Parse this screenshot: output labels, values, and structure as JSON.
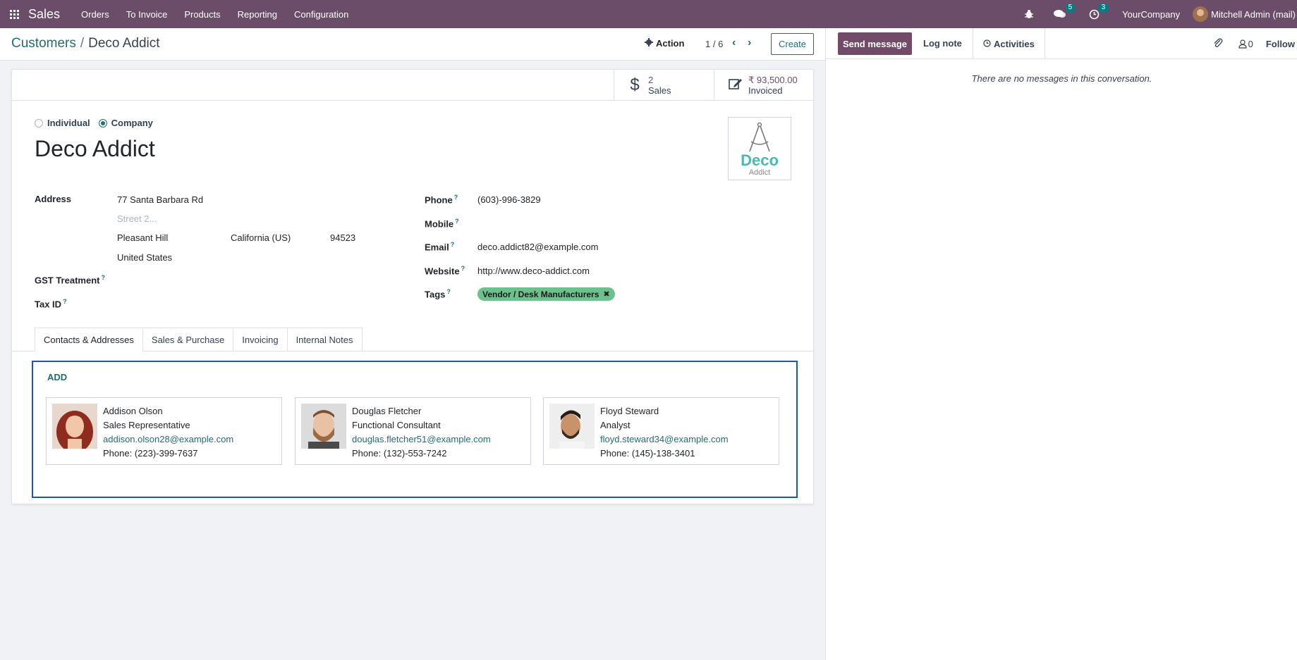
{
  "navbar": {
    "app_name": "Sales",
    "menu": [
      "Orders",
      "To Invoice",
      "Products",
      "Reporting",
      "Configuration"
    ],
    "messages_count": "5",
    "activities_count": "3",
    "company": "YourCompany",
    "user": "Mitchell Admin (mail)"
  },
  "breadcrumb": {
    "parent": "Customers",
    "separator": "/",
    "current": "Deco Addict"
  },
  "control": {
    "action_label": "Action",
    "pager": "1 / 6",
    "create_label": "Create"
  },
  "stats": [
    {
      "value": "2",
      "label": "Sales",
      "icon": "dollar-icon"
    },
    {
      "value": "₹ 93,500.00",
      "label": "Invoiced",
      "icon": "edit-invoice-icon"
    }
  ],
  "company_type": {
    "individual": "Individual",
    "company": "Company",
    "selected": "Company"
  },
  "partner": {
    "name": "Deco Addict",
    "logo_text": "Deco",
    "logo_sub": "Addict"
  },
  "address": {
    "label": "Address",
    "street": "77 Santa Barbara Rd",
    "street2_placeholder": "Street 2...",
    "city": "Pleasant Hill",
    "state": "California (US)",
    "zip": "94523",
    "country": "United States"
  },
  "fields_left": {
    "gst_label": "GST Treatment",
    "taxid_label": "Tax ID"
  },
  "fields_right": {
    "phone_label": "Phone",
    "phone": "(603)-996-3829",
    "mobile_label": "Mobile",
    "email_label": "Email",
    "email": "deco.addict82@example.com",
    "website_label": "Website",
    "website": "http://www.deco-addict.com",
    "tags_label": "Tags",
    "tag": "Vendor / Desk Manufacturers"
  },
  "tabs": [
    "Contacts & Addresses",
    "Sales & Purchase",
    "Invoicing",
    "Internal Notes"
  ],
  "contacts": {
    "add_label": "ADD",
    "items": [
      {
        "name": "Addison Olson",
        "title": "Sales Representative",
        "email": "addison.olson28@example.com",
        "phone": "Phone: (223)-399-7637"
      },
      {
        "name": "Douglas Fletcher",
        "title": "Functional Consultant",
        "email": "douglas.fletcher51@example.com",
        "phone": "Phone: (132)-553-7242"
      },
      {
        "name": "Floyd Steward",
        "title": "Analyst",
        "email": "floyd.steward34@example.com",
        "phone": "Phone: (145)-138-3401"
      }
    ]
  },
  "chatter": {
    "send_message": "Send message",
    "log_note": "Log note",
    "activities": "Activities",
    "followers_count": "0",
    "follow": "Follow",
    "empty_text": "There are no messages in this conversation."
  },
  "colors": {
    "navbar": "#6b4d6a",
    "primary": "#714b67",
    "link": "#1f6e73",
    "tag": "#6cc18e",
    "highlight": "#1a4fd6"
  }
}
